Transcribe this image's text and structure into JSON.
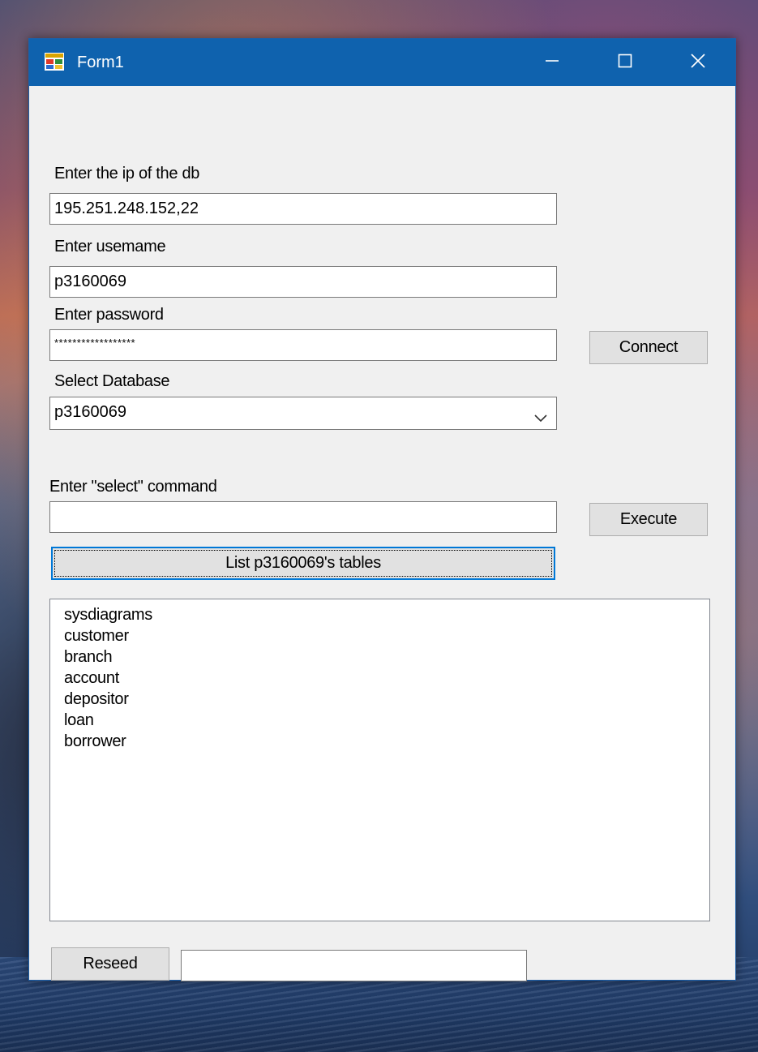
{
  "window": {
    "title": "Form1"
  },
  "form": {
    "ip_label": "Enter the ip of the db",
    "ip_value": "195.251.248.152,22",
    "username_label": "Enter usemame",
    "username_value": "p3160069",
    "password_label": "Enter password",
    "password_value": "******************",
    "database_label": "Select Database",
    "database_selected": "p3160069",
    "connect_button": "Connect",
    "select_label": "Enter \"select\" command",
    "select_value": "",
    "execute_button": "Execute",
    "list_tables_button": "List p3160069's tables",
    "tables": [
      "sysdiagrams",
      "customer",
      "branch",
      "account",
      "depositor",
      "loan",
      "borrower"
    ],
    "reseed_button": "Reseed",
    "reseed_value": ""
  },
  "icons": {
    "app": "windows-form-icon",
    "minimize": "minimize-icon",
    "maximize": "maximize-icon",
    "close": "close-icon",
    "dropdown": "chevron-down-icon"
  },
  "colors": {
    "titlebar": "#0f62ae",
    "window_bg": "#f0f0f0",
    "button_bg": "#e1e1e1",
    "focus_border": "#0078d7"
  }
}
